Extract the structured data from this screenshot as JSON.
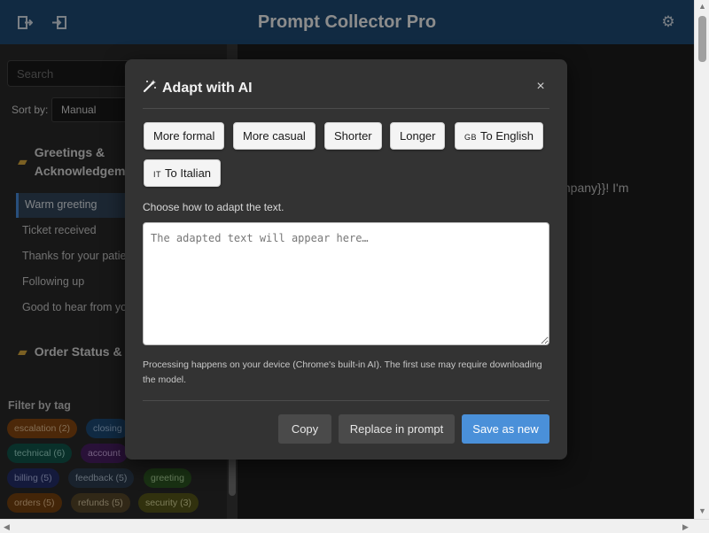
{
  "header": {
    "title": "Prompt Collector Pro"
  },
  "sidebar": {
    "search_placeholder": "Search",
    "sort_label": "Sort by:",
    "sort_value": "Manual",
    "groups": [
      {
        "label_line1": "Greetings &",
        "label_line2": "Acknowledgem"
      },
      {
        "label_line1": "Order Status &"
      }
    ],
    "items": [
      "Warm greeting",
      "Ticket received",
      "Thanks for your patie",
      "Following up",
      "Good to hear from yo"
    ],
    "filter_title": "Filter by tag",
    "tags": [
      {
        "label": "escalation (2)",
        "bg": "#8a4a12",
        "fg": "#f0c89a"
      },
      {
        "label": "closing",
        "bg": "#1e4d7a",
        "fg": "#a7c7ea"
      },
      {
        "label": "technical (6)",
        "bg": "#11584e",
        "fg": "#9fe0d2"
      },
      {
        "label": "account",
        "bg": "#4b1f66",
        "fg": "#d7b3ee"
      },
      {
        "label": "billing (5)",
        "bg": "#25306e",
        "fg": "#b6c0f0"
      },
      {
        "label": "feedback (5)",
        "bg": "#2e3e52",
        "fg": "#b8c9da"
      },
      {
        "label": "greeting",
        "bg": "#2f5a23",
        "fg": "#b9e3a6"
      },
      {
        "label": "orders (5)",
        "bg": "#7a4410",
        "fg": "#f2c694"
      },
      {
        "label": "refunds (5)",
        "bg": "#5a4a2a",
        "fg": "#e0cfa8"
      },
      {
        "label": "security (3)",
        "bg": "#5a5a1a",
        "fg": "#e0e0a0"
      }
    ]
  },
  "main": {
    "preview_line1": "mpany}}! I'm"
  },
  "modal": {
    "title": "Adapt with AI",
    "close": "×",
    "options": [
      {
        "label": "More formal"
      },
      {
        "label": "More casual"
      },
      {
        "label": "Shorter"
      },
      {
        "label": "Longer"
      },
      {
        "flag": "GB",
        "label": "To English"
      },
      {
        "flag": "IT",
        "label": "To Italian"
      }
    ],
    "hint": "Choose how to adapt the text.",
    "result_placeholder": "The adapted text will appear here…",
    "note": "Processing happens on your device (Chrome's built-in AI). The first use may require downloading the model.",
    "buttons": {
      "copy": "Copy",
      "replace": "Replace in prompt",
      "save": "Save as new"
    }
  },
  "colors": {
    "header_bg": "#1f4e79",
    "accent": "#4a90d9",
    "modal_bg": "#333333"
  }
}
